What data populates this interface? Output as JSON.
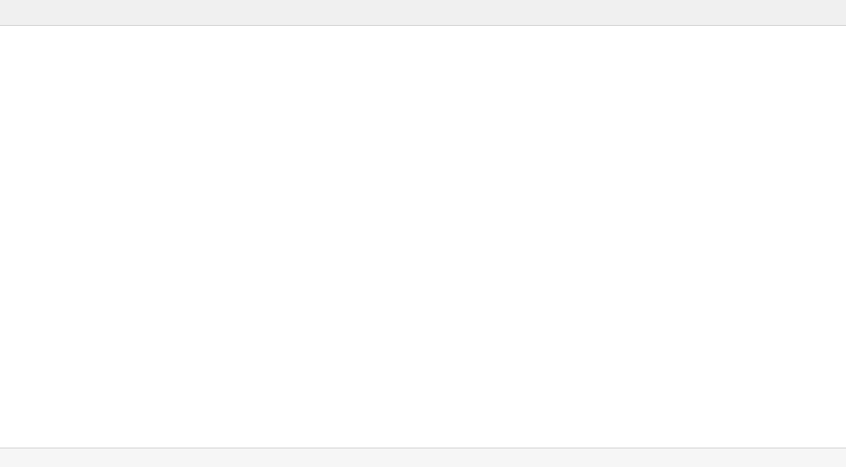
{
  "window": {
    "title": ""
  },
  "content": {
    "text": ""
  },
  "status": {
    "text": ""
  }
}
